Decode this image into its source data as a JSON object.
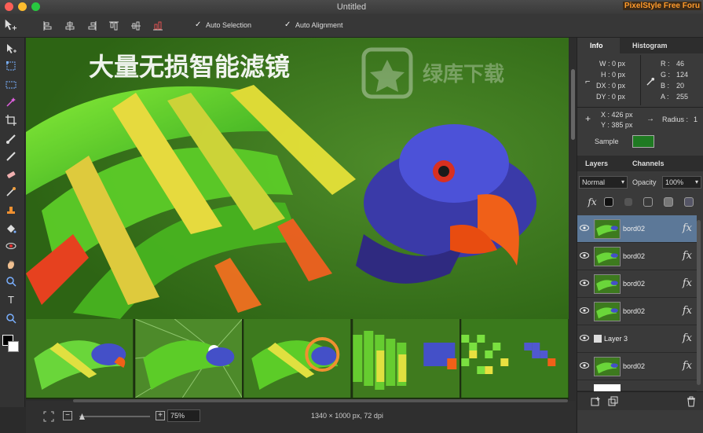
{
  "window": {
    "title": "Untitled",
    "watermark": "PixelStyle Free Foru"
  },
  "toolbar": {
    "move_tool": "move-arrow",
    "align_buttons": [
      "align-left-edges",
      "align-horizontal-centers",
      "align-right-edges",
      "align-top-edges",
      "align-vertical-centers",
      "align-bottom-edges"
    ],
    "auto_selection_label": "Auto Selection",
    "auto_alignment_label": "Auto Alignment",
    "auto_selection_checked": true,
    "auto_alignment_checked": true
  },
  "tools": [
    "move-tool",
    "transform-tool",
    "rect-select-tool",
    "magic-wand-tool",
    "crop-tool",
    "brush-tool",
    "pencil-tool",
    "eraser-tool",
    "eyedropper-tool",
    "stamp-tool",
    "fill-tool",
    "redeye-tool",
    "smudge-tool",
    "zoom-tool",
    "text-tool",
    "magnifier-tool"
  ],
  "canvas": {
    "overlay_text": "大量无损智能滤镜",
    "watermark_text": "绿库下载",
    "thumbnails": [
      "blur",
      "radial-burst",
      "halo",
      "mosaic",
      "pixelate"
    ]
  },
  "status": {
    "zoom": "75%",
    "doc_info": "1340 × 1000 px, 72 dpi"
  },
  "panel": {
    "tabs": [
      "Info",
      "Histogram"
    ],
    "info": {
      "w": "W :  0 px",
      "h": "H :  0 px",
      "dx": "DX :  0 px",
      "dy": "DY :  0 px",
      "r": "R :",
      "g": "G :",
      "b": "B :",
      "a": "A :",
      "r_val": "46",
      "g_val": "124",
      "b_val": "20",
      "a_val": "255",
      "x": "X :  426 px",
      "y": "Y :  385 px",
      "radius_label": "Radius :",
      "radius_val": "1",
      "sample_label": "Sample"
    },
    "layer_tabs": [
      "Layers",
      "Channels"
    ],
    "blend_mode": "Normal",
    "opacity_label": "Opacity",
    "opacity_value": "100%",
    "layers": [
      {
        "name": "bord02",
        "selected": true,
        "type": "image"
      },
      {
        "name": "bord02",
        "selected": false,
        "type": "image"
      },
      {
        "name": "bord02",
        "selected": false,
        "type": "image"
      },
      {
        "name": "bord02",
        "selected": false,
        "type": "image"
      },
      {
        "name": "Layer 3",
        "selected": false,
        "type": "text"
      },
      {
        "name": "bord02",
        "selected": false,
        "type": "image"
      }
    ]
  },
  "colors": {
    "accent": "#5c7898",
    "sample": "#1f7a22",
    "canvas_bg": "#3f7a1e"
  }
}
